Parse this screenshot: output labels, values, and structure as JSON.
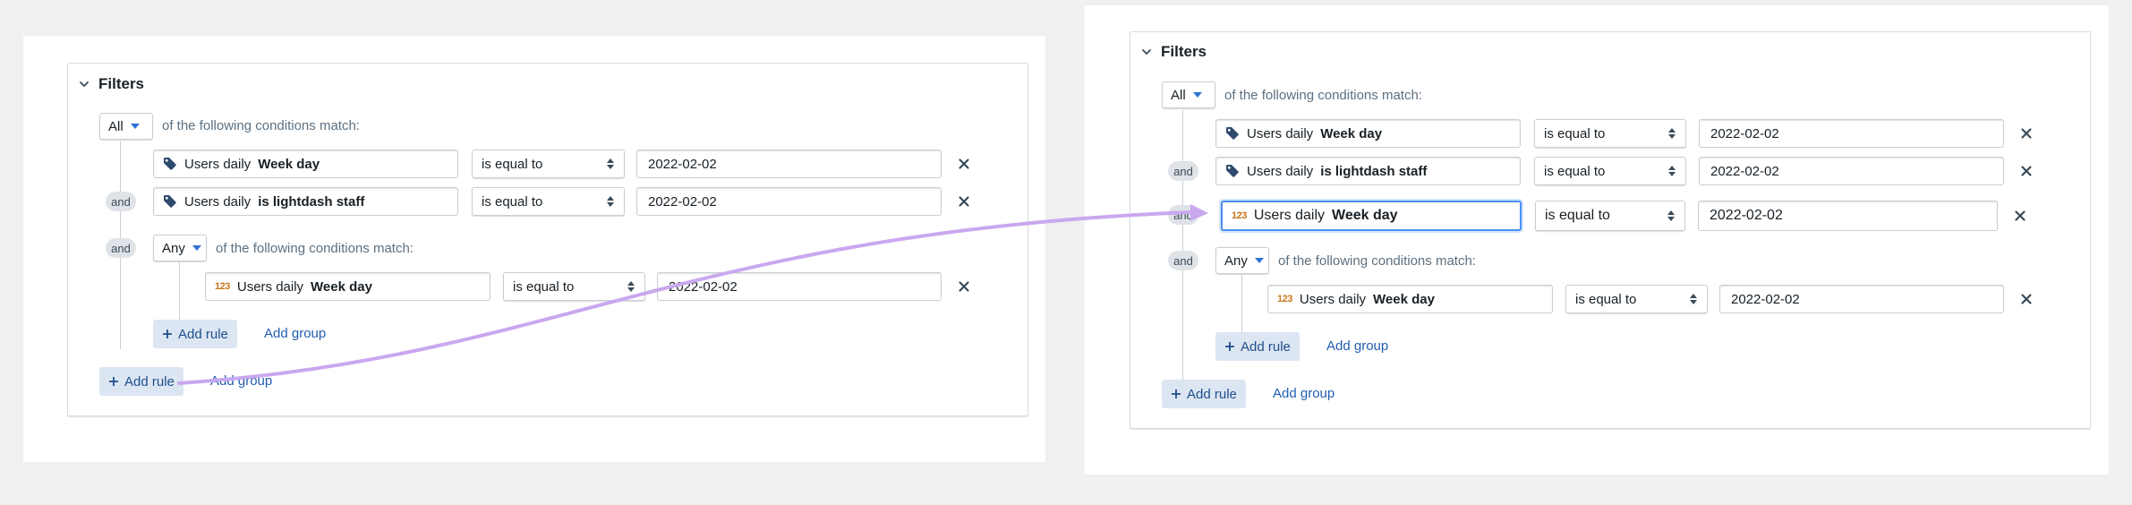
{
  "left": {
    "title": "Filters",
    "match_select": "All",
    "match_text": "of the following conditions match:",
    "rules": [
      {
        "prefix": "Users daily",
        "field": "Week day",
        "operator": "is equal to",
        "value": "2022-02-02",
        "icon": "tag-icon"
      },
      {
        "joiner": "and",
        "prefix": "Users daily",
        "field": "is lightdash staff",
        "operator": "is equal to",
        "value": "2022-02-02",
        "icon": "tag-icon"
      }
    ],
    "group": {
      "joiner": "and",
      "match_select": "Any",
      "match_text": "of the following conditions match:",
      "rule": {
        "num_icon": "123",
        "prefix": "Users daily",
        "field": "Week day",
        "operator": "is equal to",
        "value": "2022-02-02"
      },
      "add_rule": "Add rule",
      "add_group": "Add group"
    },
    "add_rule": "Add rule",
    "add_group": "Add group"
  },
  "right": {
    "title": "Filters",
    "match_select": "All",
    "match_text": "of the following conditions match:",
    "rules": [
      {
        "prefix": "Users daily",
        "field": "Week day",
        "operator": "is equal to",
        "value": "2022-02-02",
        "icon": "tag-icon"
      },
      {
        "joiner": "and",
        "prefix": "Users daily",
        "field": "is lightdash staff",
        "operator": "is equal to",
        "value": "2022-02-02",
        "icon": "tag-icon"
      },
      {
        "joiner": "and",
        "num_icon": "123",
        "prefix": "Users daily",
        "field": "Week day",
        "operator": "is equal to",
        "value": "2022-02-02"
      }
    ],
    "group": {
      "joiner": "and",
      "match_select": "Any",
      "match_text": "of the following conditions match:",
      "rule": {
        "num_icon": "123",
        "prefix": "Users daily",
        "field": "Week day",
        "operator": "is equal to",
        "value": "2022-02-02"
      },
      "add_rule": "Add rule",
      "add_group": "Add group"
    },
    "add_rule": "Add rule",
    "add_group": "Add group"
  },
  "colors": {
    "arrow": "#c9a8ef",
    "accent": "#2d72d2",
    "link": "#215db0"
  }
}
